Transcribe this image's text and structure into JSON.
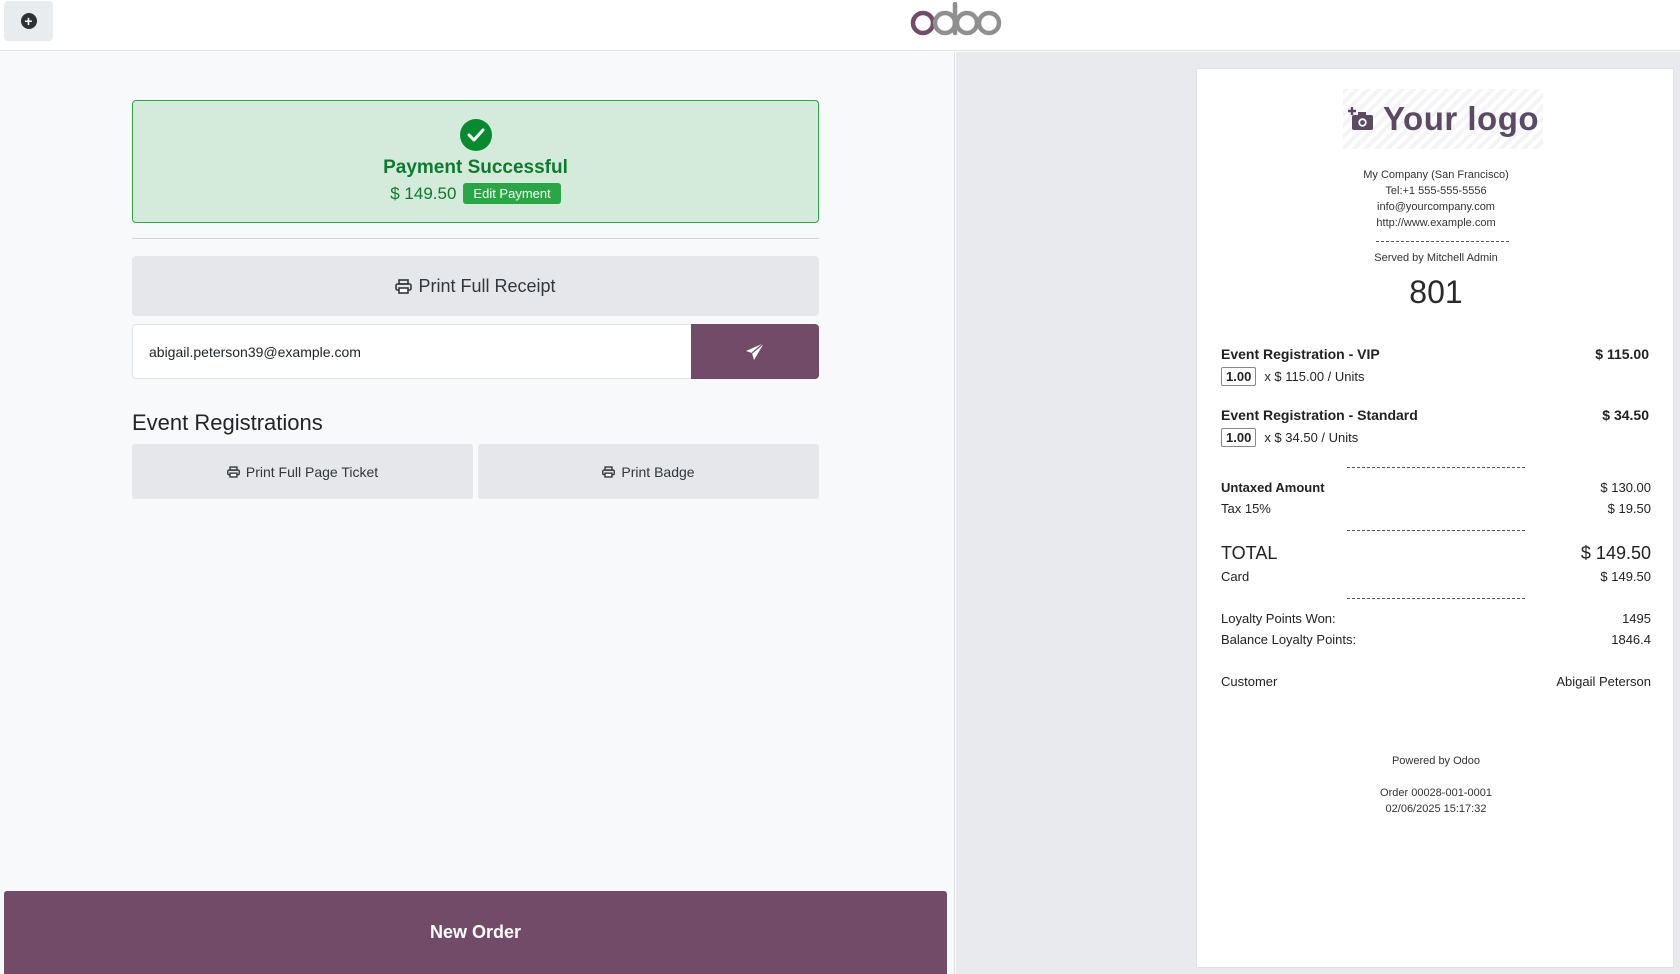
{
  "header": {
    "brand": "odoo"
  },
  "payment": {
    "title": "Payment Successful",
    "amount": "$ 149.50",
    "edit_label": "Edit Payment"
  },
  "actions": {
    "print_full_receipt": "Print Full Receipt",
    "email_value": "abigail.peterson39@example.com",
    "event_registrations_title": "Event Registrations",
    "print_full_page_ticket": "Print Full Page Ticket",
    "print_badge": "Print Badge",
    "new_order": "New Order"
  },
  "receipt": {
    "logo_text": "Your logo",
    "company": "My Company (San Francisco)",
    "tel": "Tel:+1 555-555-5556",
    "email": "info@yourcompany.com",
    "website": "http://www.example.com",
    "served_by": "Served by Mitchell Admin",
    "order_number": "801",
    "lines": [
      {
        "name": "Event Registration - VIP",
        "price": "$ 115.00",
        "qty": "1.00",
        "unit_price": "x $ 115.00 / Units"
      },
      {
        "name": "Event Registration - Standard",
        "price": "$ 34.50",
        "qty": "1.00",
        "unit_price": "x $ 34.50 / Units"
      }
    ],
    "untaxed_label": "Untaxed Amount",
    "untaxed_value": "$ 130.00",
    "tax_label": "Tax 15%",
    "tax_value": "$ 19.50",
    "total_label": "TOTAL",
    "total_value": "$ 149.50",
    "card_label": "Card",
    "card_value": "$ 149.50",
    "loyalty_won_label": "Loyalty Points Won:",
    "loyalty_won_value": "1495",
    "loyalty_balance_label": "Balance Loyalty Points:",
    "loyalty_balance_value": "1846.4",
    "customer_label": "Customer",
    "customer_value": "Abigail Peterson",
    "powered_by": "Powered by Odoo",
    "order_ref": "Order 00028-001-0001",
    "datetime": "02/06/2025 15:17:32"
  },
  "colors": {
    "brand_purple": "#714b67",
    "success_bg": "#d4ebdc",
    "success_green": "#28a745"
  }
}
